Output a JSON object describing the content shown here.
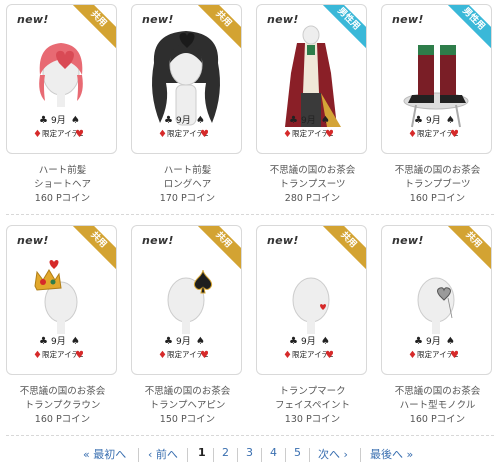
{
  "items": [
    {
      "new": "new!",
      "tag": "共用",
      "tag_color": "#d3a332",
      "name1": "ハート前髪",
      "name2": "ショートヘア",
      "price": "160 Pコイン",
      "art": "hair-short-pink-icon"
    },
    {
      "new": "new!",
      "tag": "共用",
      "tag_color": "#d3a332",
      "name1": "ハート前髪",
      "name2": "ロングヘア",
      "price": "170 Pコイン",
      "art": "hair-long-black-icon"
    },
    {
      "new": "new!",
      "tag": "男性用",
      "tag_color": "#3ab8d8",
      "name1": "不思議の国のお茶会",
      "name2": "トランプスーツ",
      "price": "280 Pコイン",
      "art": "trump-suit-icon"
    },
    {
      "new": "new!",
      "tag": "男性用",
      "tag_color": "#3ab8d8",
      "name1": "不思議の国のお茶会",
      "name2": "トランプブーツ",
      "price": "160 Pコイン",
      "art": "trump-boots-icon"
    },
    {
      "new": "new!",
      "tag": "共用",
      "tag_color": "#d3a332",
      "name1": "不思議の国のお茶会",
      "name2": "トランプクラウン",
      "price": "160 Pコイン",
      "art": "trump-crown-icon"
    },
    {
      "new": "new!",
      "tag": "共用",
      "tag_color": "#d3a332",
      "name1": "不思議の国のお茶会",
      "name2": "トランプヘアピン",
      "price": "150 Pコイン",
      "art": "trump-hairpin-icon"
    },
    {
      "new": "new!",
      "tag": "共用",
      "tag_color": "#d3a332",
      "name1": "トランプマーク",
      "name2": "フェイスペイント",
      "price": "130 Pコイン",
      "art": "face-paint-icon"
    },
    {
      "new": "new!",
      "tag": "共用",
      "tag_color": "#d3a332",
      "name1": "不思議の国のお茶会",
      "name2": "ハート型モノクル",
      "price": "160 Pコイン",
      "art": "heart-monocle-icon"
    }
  ],
  "badge": {
    "month": "9月",
    "label": "限定アイテム"
  },
  "pager": {
    "first": "« 最初へ",
    "prev": "‹ 前へ",
    "pages": [
      "1",
      "2",
      "3",
      "4",
      "5"
    ],
    "current": "1",
    "next": "次へ ›",
    "last": "最後へ »"
  }
}
